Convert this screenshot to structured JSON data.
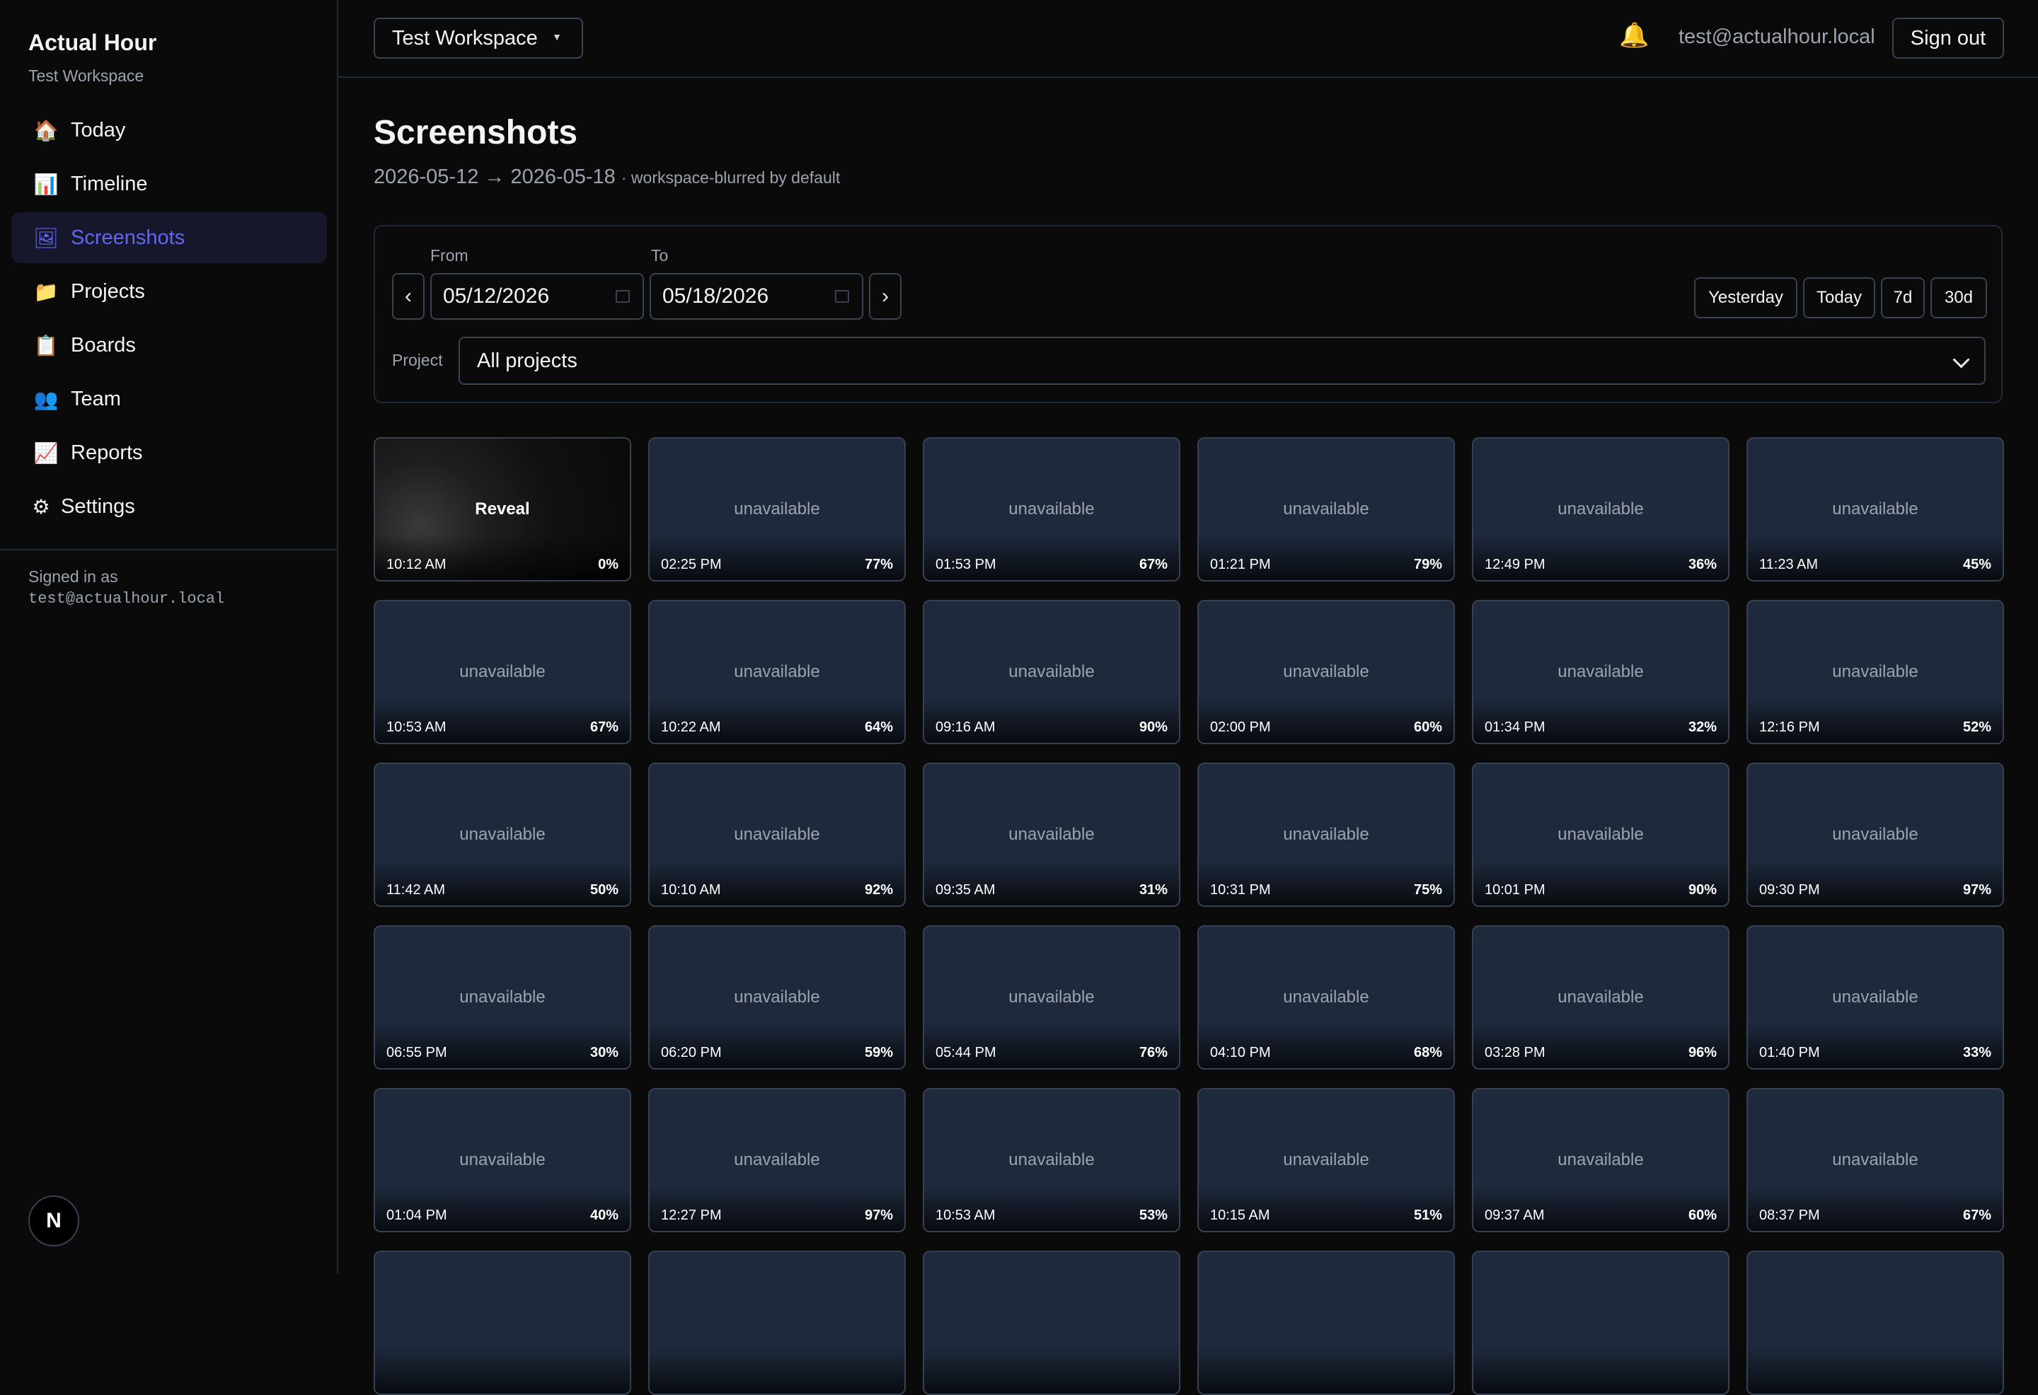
{
  "sidebar": {
    "brand_title": "Actual Hour",
    "brand_subtitle": "Test Workspace",
    "items": [
      {
        "label": "Today",
        "icon": "🏠"
      },
      {
        "label": "Timeline",
        "icon": "📊"
      },
      {
        "label": "Screenshots",
        "icon": "🖼",
        "active": true
      },
      {
        "label": "Projects",
        "icon": "📁"
      },
      {
        "label": "Boards",
        "icon": "📋"
      },
      {
        "label": "Team",
        "icon": "👥"
      },
      {
        "label": "Reports",
        "icon": "📈"
      },
      {
        "label": "Settings",
        "icon": "⚙"
      }
    ],
    "signed_in_label": "Signed in as",
    "signed_in_email": "test@actualhour.local",
    "badge_letter": "N"
  },
  "topbar": {
    "workspace": "Test Workspace",
    "workspace_caret": "▼",
    "bell_icon": "🔔",
    "user_email": "test@actualhour.local",
    "sign_out": "Sign out"
  },
  "page": {
    "title": "Screenshots",
    "range": "2026-05-12 → 2026-05-18",
    "range_note": "· workspace-blurred by default"
  },
  "filters": {
    "from_label": "From",
    "to_label": "To",
    "prev": "‹",
    "next": "›",
    "from_value": "05/12/2026",
    "to_value": "05/18/2026",
    "quick": [
      "Yesterday",
      "Today",
      "7d",
      "30d"
    ],
    "project_label": "Project",
    "project_value": "All projects"
  },
  "tiles": [
    {
      "label": "Reveal",
      "time": "10:12 AM",
      "pct": "0%",
      "blurred": true
    },
    {
      "label": "unavailable",
      "time": "02:25 PM",
      "pct": "77%"
    },
    {
      "label": "unavailable",
      "time": "01:53 PM",
      "pct": "67%"
    },
    {
      "label": "unavailable",
      "time": "01:21 PM",
      "pct": "79%"
    },
    {
      "label": "unavailable",
      "time": "12:49 PM",
      "pct": "36%"
    },
    {
      "label": "unavailable",
      "time": "11:23 AM",
      "pct": "45%"
    },
    {
      "label": "unavailable",
      "time": "10:53 AM",
      "pct": "67%"
    },
    {
      "label": "unavailable",
      "time": "10:22 AM",
      "pct": "64%"
    },
    {
      "label": "unavailable",
      "time": "09:16 AM",
      "pct": "90%"
    },
    {
      "label": "unavailable",
      "time": "02:00 PM",
      "pct": "60%"
    },
    {
      "label": "unavailable",
      "time": "01:34 PM",
      "pct": "32%"
    },
    {
      "label": "unavailable",
      "time": "12:16 PM",
      "pct": "52%"
    },
    {
      "label": "unavailable",
      "time": "11:42 AM",
      "pct": "50%"
    },
    {
      "label": "unavailable",
      "time": "10:10 AM",
      "pct": "92%"
    },
    {
      "label": "unavailable",
      "time": "09:35 AM",
      "pct": "31%"
    },
    {
      "label": "unavailable",
      "time": "10:31 PM",
      "pct": "75%"
    },
    {
      "label": "unavailable",
      "time": "10:01 PM",
      "pct": "90%"
    },
    {
      "label": "unavailable",
      "time": "09:30 PM",
      "pct": "97%"
    },
    {
      "label": "unavailable",
      "time": "06:55 PM",
      "pct": "30%"
    },
    {
      "label": "unavailable",
      "time": "06:20 PM",
      "pct": "59%"
    },
    {
      "label": "unavailable",
      "time": "05:44 PM",
      "pct": "76%"
    },
    {
      "label": "unavailable",
      "time": "04:10 PM",
      "pct": "68%"
    },
    {
      "label": "unavailable",
      "time": "03:28 PM",
      "pct": "96%"
    },
    {
      "label": "unavailable",
      "time": "01:40 PM",
      "pct": "33%"
    },
    {
      "label": "unavailable",
      "time": "01:04 PM",
      "pct": "40%"
    },
    {
      "label": "unavailable",
      "time": "12:27 PM",
      "pct": "97%"
    },
    {
      "label": "unavailable",
      "time": "10:53 AM",
      "pct": "53%"
    },
    {
      "label": "unavailable",
      "time": "10:15 AM",
      "pct": "51%"
    },
    {
      "label": "unavailable",
      "time": "09:37 AM",
      "pct": "60%"
    },
    {
      "label": "unavailable",
      "time": "08:37 PM",
      "pct": "67%"
    },
    {
      "label": "",
      "time": "",
      "pct": ""
    },
    {
      "label": "",
      "time": "",
      "pct": ""
    },
    {
      "label": "",
      "time": "",
      "pct": ""
    },
    {
      "label": "",
      "time": "",
      "pct": ""
    },
    {
      "label": "",
      "time": "",
      "pct": ""
    },
    {
      "label": "",
      "time": "",
      "pct": ""
    }
  ],
  "colors": {
    "accent": "#6366f1",
    "bell": "#f59e0b",
    "tile_bg": "#1e293b",
    "background": "#0a0a0b"
  }
}
